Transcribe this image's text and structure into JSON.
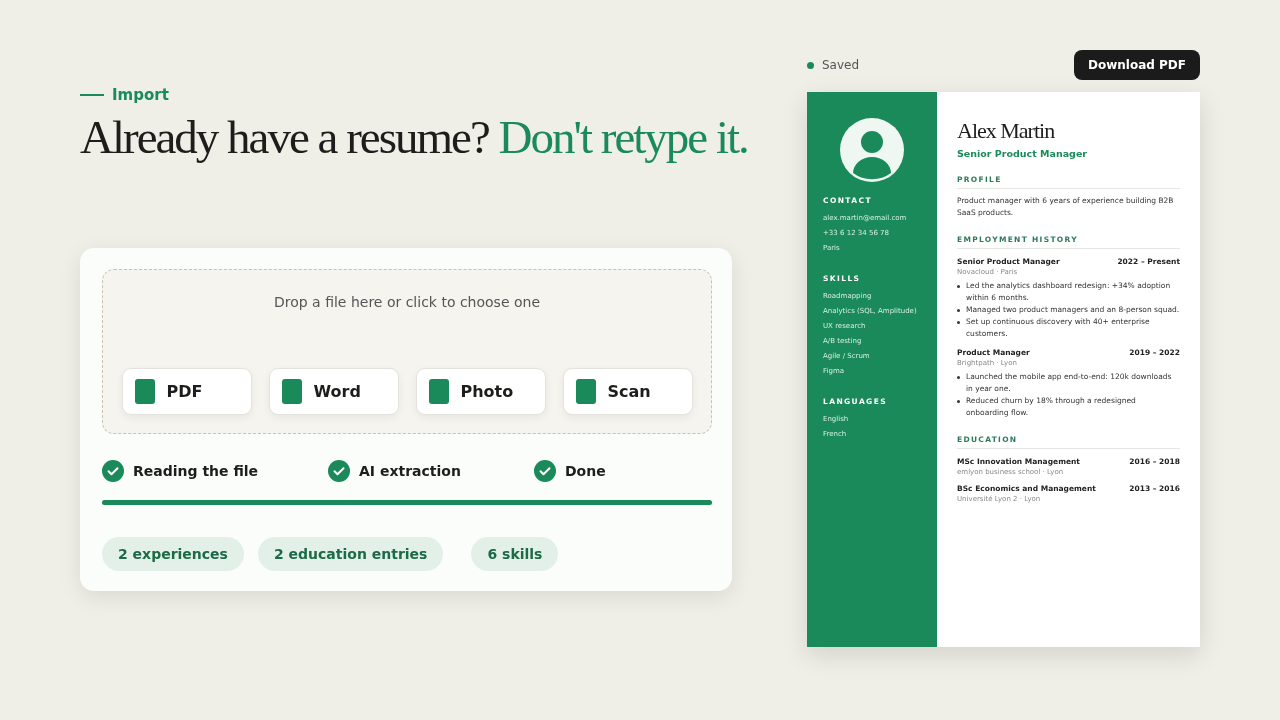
{
  "section_label": "Import",
  "heading": {
    "text": "Already have a resume?",
    "accent": "Don't retype it."
  },
  "dropzone": {
    "prompt": "Drop a file here or click to choose one",
    "file_types": [
      {
        "label": "PDF"
      },
      {
        "label": "Word"
      },
      {
        "label": "Photo"
      },
      {
        "label": "Scan"
      }
    ]
  },
  "steps": [
    {
      "label": "Reading the file",
      "done": true
    },
    {
      "label": "AI extraction",
      "done": true
    },
    {
      "label": "Done",
      "done": true
    }
  ],
  "progress": {
    "level": 1
  },
  "summary_chips": [
    "2 experiences",
    "2 education entries",
    "6 skills"
  ],
  "save_status": "Saved",
  "download_button": "Download PDF",
  "resume": {
    "name": "Alex Martin",
    "title": "Senior Product Manager",
    "sidebar": [
      {
        "heading": "CONTACT",
        "items": [
          "alex.martin@email.com",
          "+33 6 12 34 56 78",
          "Paris"
        ]
      },
      {
        "heading": "SKILLS",
        "items": [
          "Roadmapping",
          "Analytics (SQL, Amplitude)",
          "UX research",
          "A/B testing",
          "Agile / Scrum",
          "Figma"
        ]
      },
      {
        "heading": "LANGUAGES",
        "items": [
          "English",
          "French"
        ]
      }
    ],
    "profile": {
      "heading": "PROFILE",
      "text": "Product manager with 6 years of experience building B2B SaaS products."
    },
    "employment": {
      "heading": "EMPLOYMENT HISTORY",
      "jobs": [
        {
          "title": "Senior Product Manager",
          "dates": "2022 – Present",
          "place": "Novacloud · Paris",
          "bullets": [
            "Led the analytics dashboard redesign: +34% adoption within 6 months.",
            "Managed two product managers and an 8-person squad.",
            "Set up continuous discovery with 40+ enterprise customers."
          ]
        },
        {
          "title": "Product Manager",
          "dates": "2019 – 2022",
          "place": "Brightpath · Lyon",
          "bullets": [
            "Launched the mobile app end-to-end: 120k downloads in year one.",
            "Reduced churn by 18% through a redesigned onboarding flow."
          ]
        }
      ]
    },
    "education": {
      "heading": "EDUCATION",
      "entries": [
        {
          "degree": "MSc Innovation Management",
          "dates": "2016 – 2018",
          "place": "emlyon business school · Lyon"
        },
        {
          "degree": "BSc Economics and Management",
          "dates": "2013 – 2016",
          "place": "Université Lyon 2 · Lyon"
        }
      ]
    }
  }
}
